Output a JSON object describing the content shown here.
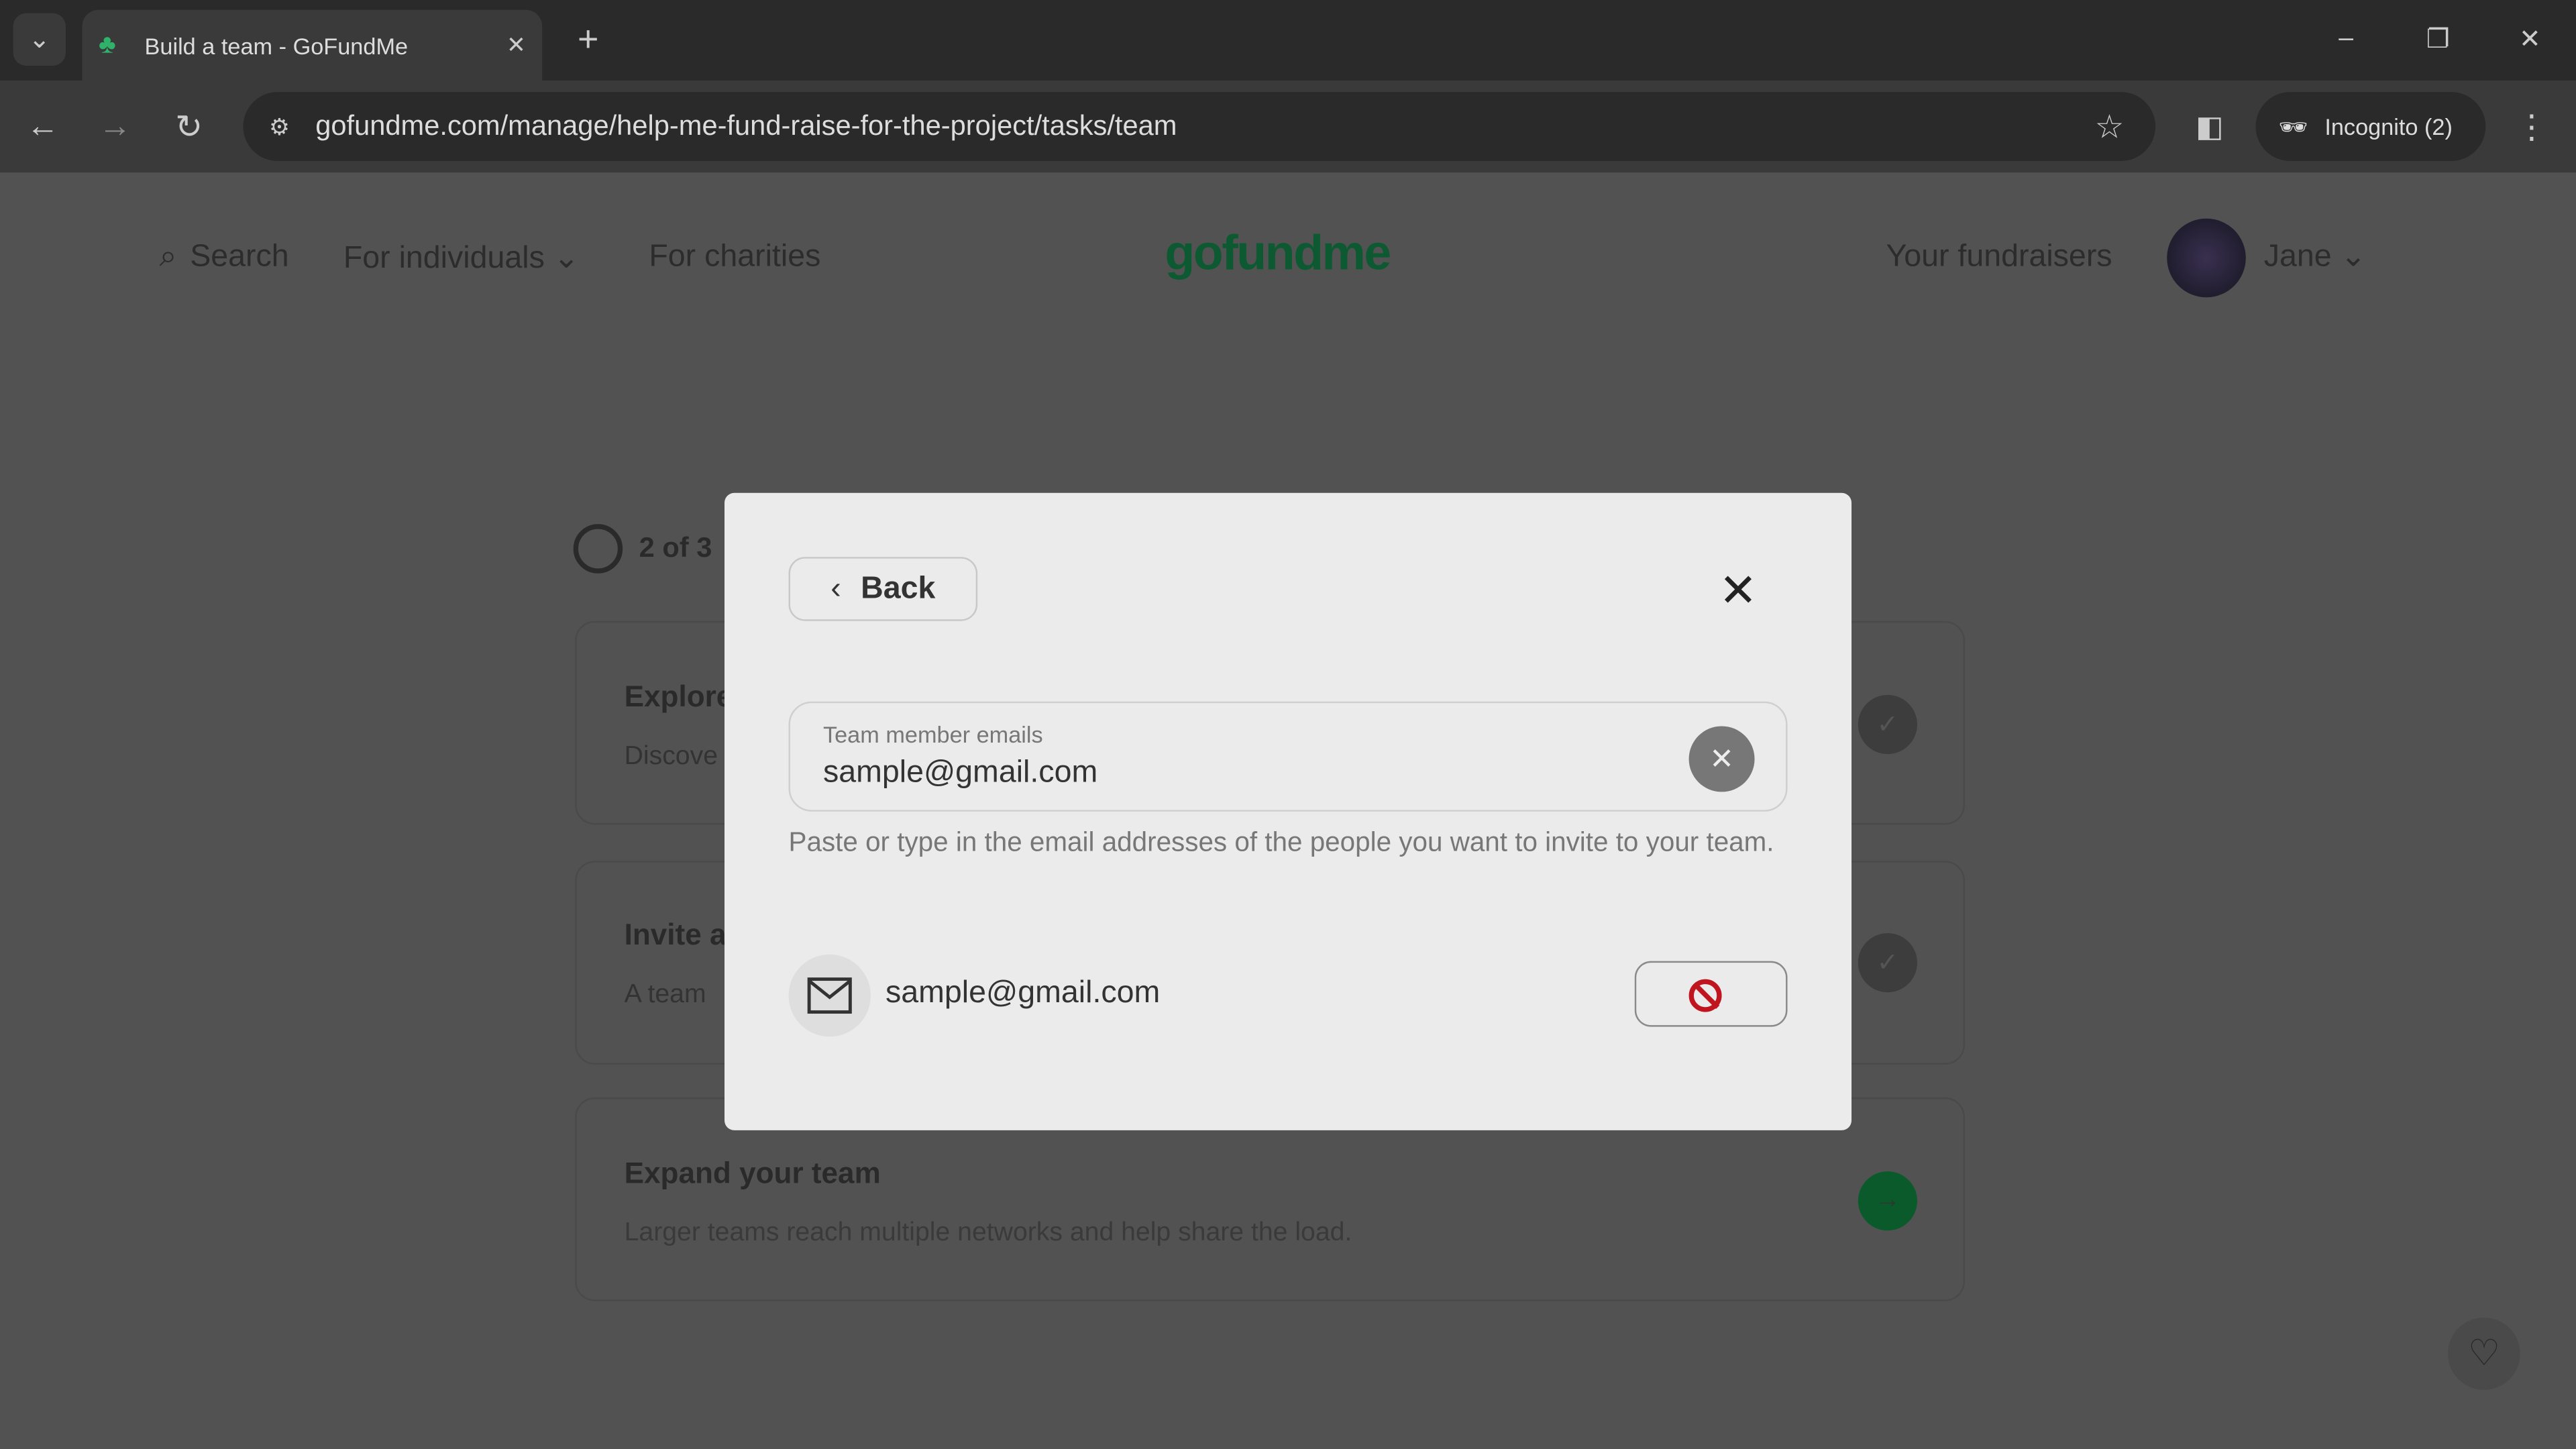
{
  "browser": {
    "tab_title": "Build a team - GoFundMe",
    "url": "gofundme.com/manage/help-me-fund-raise-for-the-project/tasks/team",
    "incognito_label": "Incognito (2)"
  },
  "header": {
    "search": "Search",
    "for_individuals": "For individuals",
    "for_charities": "For charities",
    "logo": "gofundme",
    "your_fundraisers": "Your fundraisers",
    "user": "Jane"
  },
  "progress": {
    "label": "2 of 3"
  },
  "tasks": [
    {
      "title": "Explore",
      "subtitle": "Discove"
    },
    {
      "title": "Invite a",
      "subtitle": "A team"
    },
    {
      "title": "Expand your team",
      "subtitle": "Larger teams reach multiple networks and help share the load."
    }
  ],
  "modal": {
    "back_label": "Back",
    "field_label": "Team member emails",
    "field_value": "sample@gmail.com",
    "hint": "Paste or type in the email addresses of the people you want to invite to your team.",
    "invitees": [
      {
        "email": "sample@gmail.com"
      }
    ]
  },
  "colors": {
    "brand": "#02a95c",
    "overlay": "#525252"
  }
}
